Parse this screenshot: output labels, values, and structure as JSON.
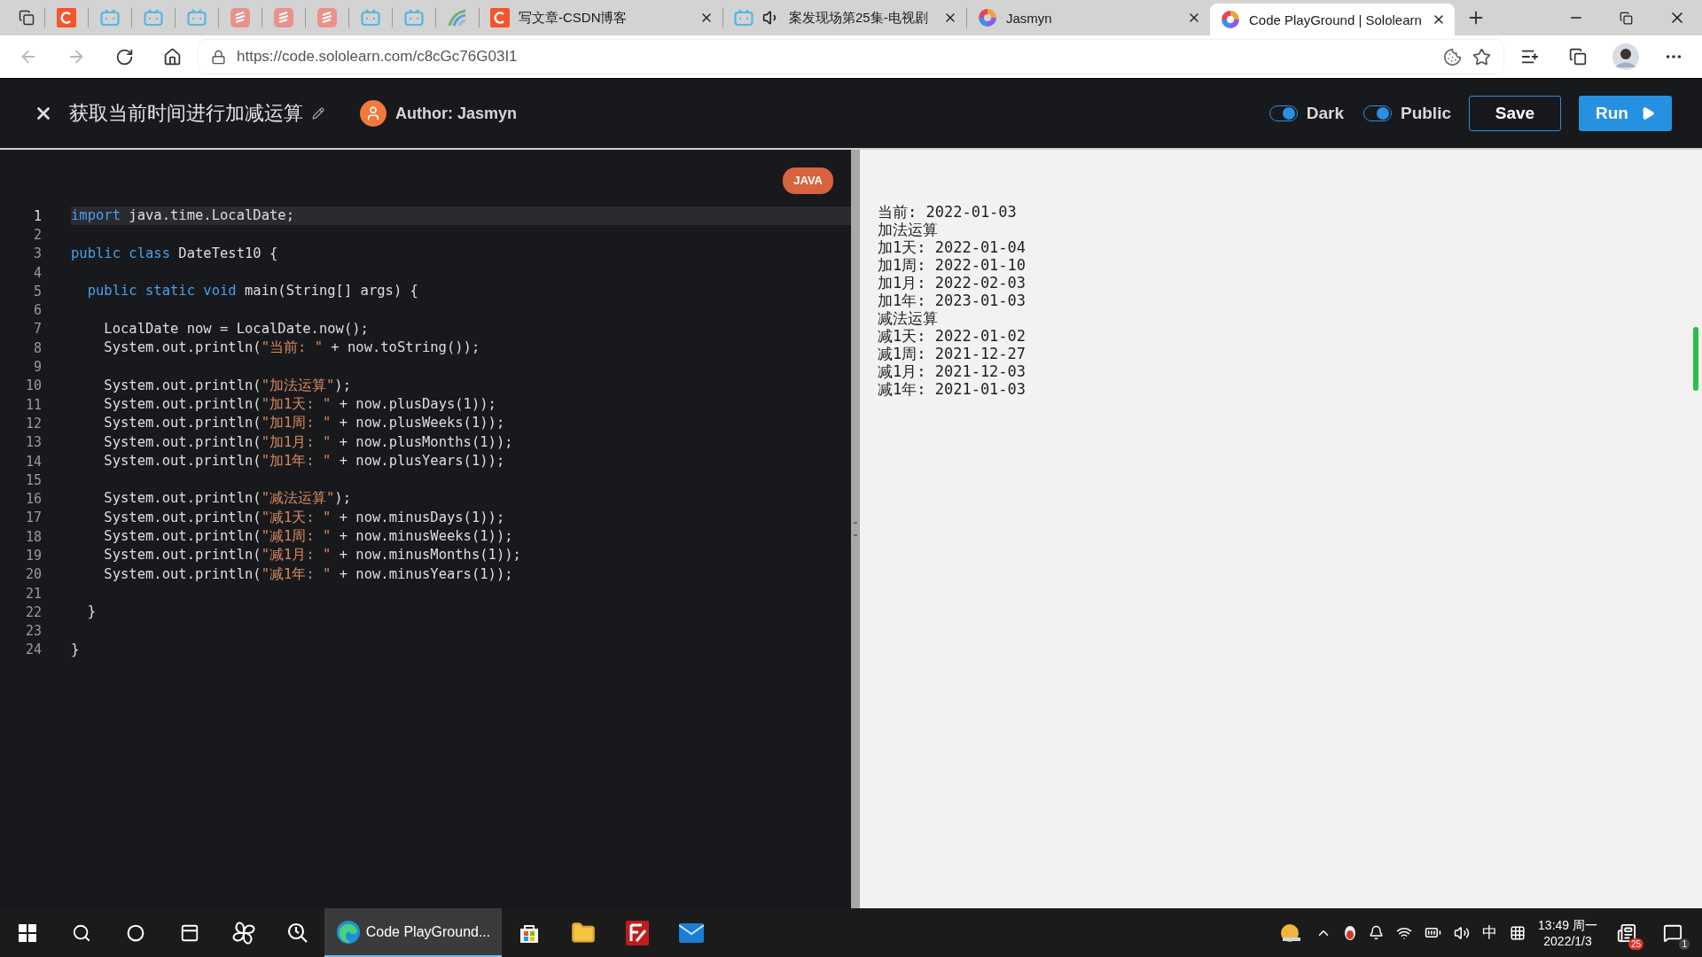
{
  "browser": {
    "tabs": [
      {
        "kind": "c",
        "selected": false
      },
      {
        "kind": "tv",
        "selected": false
      },
      {
        "kind": "tv",
        "selected": false
      },
      {
        "kind": "tv",
        "selected": false
      },
      {
        "kind": "stack",
        "selected": false
      },
      {
        "kind": "stack",
        "selected": false
      },
      {
        "kind": "stack",
        "selected": false
      },
      {
        "kind": "tv",
        "selected": false
      },
      {
        "kind": "tv",
        "selected": false
      },
      {
        "kind": "wave",
        "selected": false
      },
      {
        "kind": "c",
        "title": "写文章-CSDN博客",
        "selected": false
      },
      {
        "kind": "tv",
        "title": "案发现场第25集-电视剧",
        "audio": true,
        "selected": false
      },
      {
        "kind": "swirl",
        "title": "Jasmyn",
        "selected": false
      },
      {
        "kind": "swirl",
        "title": "Code PlayGround | Sololearn",
        "selected": true
      }
    ],
    "url": "https://code.sololearn.com/c8cGc76G03I1"
  },
  "header": {
    "title": "获取当前时间进行加减运算",
    "author": "Author: Jasmyn",
    "toggles": [
      {
        "label": "Dark",
        "on": true
      },
      {
        "label": "Public",
        "on": true
      }
    ],
    "save": "Save",
    "run": "Run"
  },
  "editor": {
    "language": "JAVA",
    "lines": [
      {
        "number": "1",
        "active": true,
        "tokens": [
          {
            "kind": "kw",
            "text": "import"
          },
          {
            "kind": "plain",
            "text": " java.time.LocalDate;"
          }
        ]
      },
      {
        "number": "2",
        "active": false
      },
      {
        "number": "3",
        "active": false,
        "tokens": [
          {
            "kind": "kw",
            "text": "public class"
          },
          {
            "kind": "plain",
            "text": " DateTest10 {"
          }
        ]
      },
      {
        "number": "4",
        "active": false
      },
      {
        "number": "5",
        "active": false,
        "tokens": [
          {
            "kind": "kw",
            "text": "  public static void"
          },
          {
            "kind": "plain",
            "text": " main(String[] args) {"
          }
        ]
      },
      {
        "number": "6",
        "active": false
      },
      {
        "number": "7",
        "active": false,
        "tokens": [
          {
            "kind": "plain",
            "text": "    LocalDate now = LocalDate.now();"
          }
        ]
      },
      {
        "number": "8",
        "active": false,
        "tokens": [
          {
            "kind": "plain",
            "text": "    System.out.println("
          },
          {
            "kind": "str",
            "text": "\"当前: \""
          },
          {
            "kind": "plain",
            "text": " + now.toString());"
          }
        ]
      },
      {
        "number": "9",
        "active": false
      },
      {
        "number": "10",
        "active": false,
        "tokens": [
          {
            "kind": "plain",
            "text": "    System.out.println("
          },
          {
            "kind": "str",
            "text": "\"加法运算\""
          },
          {
            "kind": "plain",
            "text": ");"
          }
        ]
      },
      {
        "number": "11",
        "active": false,
        "tokens": [
          {
            "kind": "plain",
            "text": "    System.out.println("
          },
          {
            "kind": "str",
            "text": "\"加1天: \""
          },
          {
            "kind": "plain",
            "text": " + now.plusDays(1));"
          }
        ]
      },
      {
        "number": "12",
        "active": false,
        "tokens": [
          {
            "kind": "plain",
            "text": "    System.out.println("
          },
          {
            "kind": "str",
            "text": "\"加1周: \""
          },
          {
            "kind": "plain",
            "text": " + now.plusWeeks(1));"
          }
        ]
      },
      {
        "number": "13",
        "active": false,
        "tokens": [
          {
            "kind": "plain",
            "text": "    System.out.println("
          },
          {
            "kind": "str",
            "text": "\"加1月: \""
          },
          {
            "kind": "plain",
            "text": " + now.plusMonths(1));"
          }
        ]
      },
      {
        "number": "14",
        "active": false,
        "tokens": [
          {
            "kind": "plain",
            "text": "    System.out.println("
          },
          {
            "kind": "str",
            "text": "\"加1年: \""
          },
          {
            "kind": "plain",
            "text": " + now.plusYears(1));"
          }
        ]
      },
      {
        "number": "15",
        "active": false
      },
      {
        "number": "16",
        "active": false,
        "tokens": [
          {
            "kind": "plain",
            "text": "    System.out.println("
          },
          {
            "kind": "str",
            "text": "\"减法运算\""
          },
          {
            "kind": "plain",
            "text": ");"
          }
        ]
      },
      {
        "number": "17",
        "active": false,
        "tokens": [
          {
            "kind": "plain",
            "text": "    System.out.println("
          },
          {
            "kind": "str",
            "text": "\"减1天: \""
          },
          {
            "kind": "plain",
            "text": " + now.minusDays(1));"
          }
        ]
      },
      {
        "number": "18",
        "active": false,
        "tokens": [
          {
            "kind": "plain",
            "text": "    System.out.println("
          },
          {
            "kind": "str",
            "text": "\"减1周: \""
          },
          {
            "kind": "plain",
            "text": " + now.minusWeeks(1));"
          }
        ]
      },
      {
        "number": "19",
        "active": false,
        "tokens": [
          {
            "kind": "plain",
            "text": "    System.out.println("
          },
          {
            "kind": "str",
            "text": "\"减1月: \""
          },
          {
            "kind": "plain",
            "text": " + now.minusMonths(1));"
          }
        ]
      },
      {
        "number": "20",
        "active": false,
        "tokens": [
          {
            "kind": "plain",
            "text": "    System.out.println("
          },
          {
            "kind": "str",
            "text": "\"减1年: \""
          },
          {
            "kind": "plain",
            "text": " + now.minusYears(1));"
          }
        ]
      },
      {
        "number": "21",
        "active": false
      },
      {
        "number": "22",
        "active": false,
        "tokens": [
          {
            "kind": "plain",
            "text": "  }"
          }
        ]
      },
      {
        "number": "23",
        "active": false
      },
      {
        "number": "24",
        "active": false,
        "tokens": [
          {
            "kind": "plain",
            "text": "}"
          }
        ]
      }
    ]
  },
  "output": {
    "lines": [
      "当前: 2022-01-03",
      "加法运算",
      "加1天: 2022-01-04",
      "加1周: 2022-01-10",
      "加1月: 2022-02-03",
      "加1年: 2023-01-03",
      "减法运算",
      "减1天: 2022-01-02",
      "减1周: 2021-12-27",
      "减1月: 2021-12-03",
      "减1年: 2021-01-03"
    ]
  },
  "taskbar": {
    "apps": [
      {
        "kind": "start",
        "selected": false
      },
      {
        "kind": "search",
        "selected": false
      },
      {
        "kind": "cortana",
        "selected": false
      },
      {
        "kind": "taskview",
        "selected": false
      },
      {
        "kind": "fan",
        "selected": false
      },
      {
        "kind": "magnifier",
        "selected": false
      },
      {
        "kind": "edge",
        "label": "Code PlayGround...",
        "selected": true
      },
      {
        "kind": "store",
        "selected": false
      },
      {
        "kind": "folder",
        "selected": false
      },
      {
        "kind": "filezilla",
        "selected": false
      },
      {
        "kind": "mail",
        "selected": false
      }
    ],
    "ime": "中",
    "time": "13:49 周一",
    "date": "2022/1/3",
    "news_badge": "25",
    "notifications": "1"
  }
}
